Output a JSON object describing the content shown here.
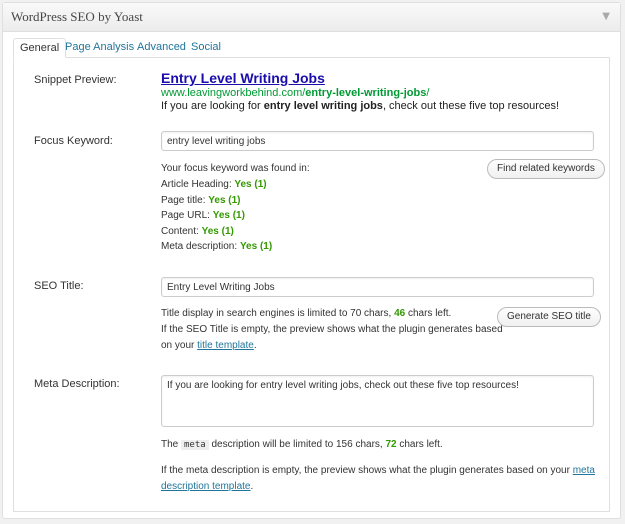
{
  "box": {
    "title": "WordPress SEO by Yoast",
    "toggle_icon": "triangle-down-icon"
  },
  "tabs": [
    {
      "label": "General"
    },
    {
      "label": "Page Analysis"
    },
    {
      "label": "Advanced"
    },
    {
      "label": "Social"
    }
  ],
  "snippet": {
    "label": "Snippet Preview:",
    "title": "Entry Level Writing Jobs",
    "url_prefix": "www.leavingworkbehind.com/",
    "url_bold": "entry-level-writing-jobs",
    "url_suffix": "/",
    "desc_pre": "If you are looking for ",
    "desc_bold": "entry level writing jobs",
    "desc_post": ", check out these five top resources!"
  },
  "focus": {
    "label": "Focus Keyword:",
    "value": "entry level writing jobs",
    "found_text": "Your focus keyword was found in:",
    "button": "Find related keywords",
    "results": [
      {
        "name": "Article Heading:",
        "value": "Yes (1)"
      },
      {
        "name": "Page title:",
        "value": "Yes (1)"
      },
      {
        "name": "Page URL:",
        "value": "Yes (1)"
      },
      {
        "name": "Content:",
        "value": "Yes (1)"
      },
      {
        "name": "Meta description:",
        "value": "Yes (1)"
      }
    ]
  },
  "seo_title": {
    "label": "SEO Title:",
    "value": "Entry Level Writing Jobs",
    "info_pre": "Title display in search engines is limited to 70 chars, ",
    "chars_left": "46",
    "info_post": " chars left.",
    "empty_note": "If the SEO Title is empty, the preview shows what the plugin generates based",
    "empty_note2_pre": "on your ",
    "template_link": "title template",
    "empty_note2_post": ".",
    "button": "Generate SEO title"
  },
  "meta_desc": {
    "label": "Meta Description:",
    "value": "If you are looking for entry level writing jobs, check out these five top resources!",
    "limit_pre": "The ",
    "limit_code": "meta",
    "limit_mid": " description will be limited to 156 chars, ",
    "chars_left": "72",
    "limit_post": " chars left.",
    "empty_note": "If the meta description is empty, the preview shows what the plugin generates based on your ",
    "template_link_1": "meta",
    "template_link_2": "description template",
    "empty_note_post": "."
  }
}
